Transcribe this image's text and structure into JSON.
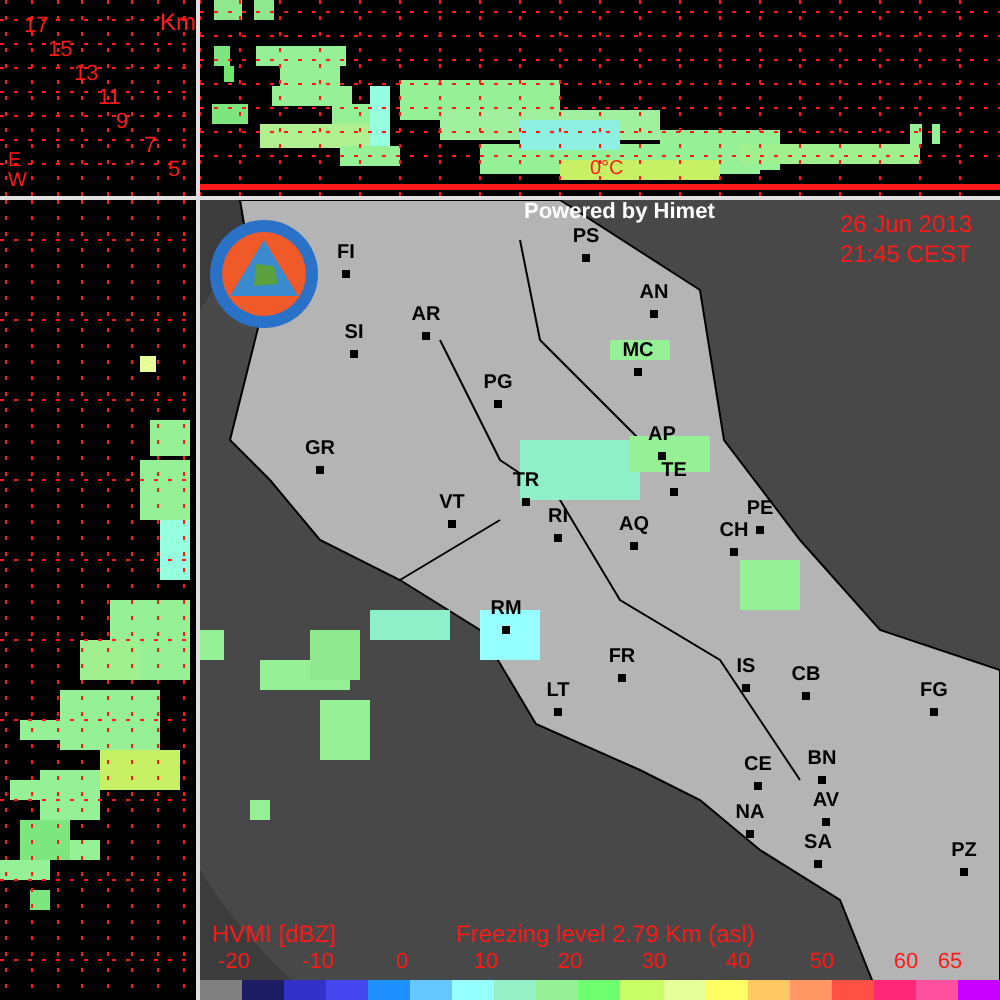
{
  "height_scale": {
    "unit": "Km",
    "labels": [
      "17",
      "15",
      "13",
      "11",
      "9",
      "7",
      "5"
    ],
    "axis_labels": [
      "E",
      "W"
    ]
  },
  "cross_section_top": {
    "freezing_label": "0°C"
  },
  "map": {
    "credit": "Powered by Himet",
    "date": "26 Jun 2013",
    "time": "21:45 CEST",
    "cities": [
      {
        "label": "PS"
      },
      {
        "label": "FI"
      },
      {
        "label": "AN"
      },
      {
        "label": "AR"
      },
      {
        "label": "SI"
      },
      {
        "label": "MC"
      },
      {
        "label": "PG"
      },
      {
        "label": "AP"
      },
      {
        "label": "GR"
      },
      {
        "label": "TE"
      },
      {
        "label": "TR"
      },
      {
        "label": "VT"
      },
      {
        "label": "PE"
      },
      {
        "label": "RI"
      },
      {
        "label": "AQ"
      },
      {
        "label": "CH"
      },
      {
        "label": "RM"
      },
      {
        "label": "FR"
      },
      {
        "label": "IS"
      },
      {
        "label": "CB"
      },
      {
        "label": "LT"
      },
      {
        "label": "FG"
      },
      {
        "label": "BN"
      },
      {
        "label": "CE"
      },
      {
        "label": "AV"
      },
      {
        "label": "NA"
      },
      {
        "label": "SA"
      },
      {
        "label": "PZ"
      }
    ]
  },
  "legend": {
    "title": "HVMI [dBZ]",
    "freezing_level": "Freezing level  2.79 Km (asl)",
    "ticks": [
      "-20",
      "-10",
      "0",
      "10",
      "20",
      "30",
      "40",
      "50",
      "60",
      "65"
    ],
    "swatches": [
      {
        "color": "#808080"
      },
      {
        "color": "#1c1c64"
      },
      {
        "color": "#3232c8"
      },
      {
        "color": "#4646f0"
      },
      {
        "color": "#1e90ff"
      },
      {
        "color": "#64c8ff"
      },
      {
        "color": "#96ffff"
      },
      {
        "color": "#96f0c8"
      },
      {
        "color": "#96f096"
      },
      {
        "color": "#6eff6e"
      },
      {
        "color": "#c8ff64"
      },
      {
        "color": "#e6ff96"
      },
      {
        "color": "#ffff64"
      },
      {
        "color": "#ffc864"
      },
      {
        "color": "#ff9664"
      },
      {
        "color": "#ff5046"
      },
      {
        "color": "#ff2878"
      },
      {
        "color": "#ff50a0"
      },
      {
        "color": "#c800ff"
      }
    ]
  }
}
